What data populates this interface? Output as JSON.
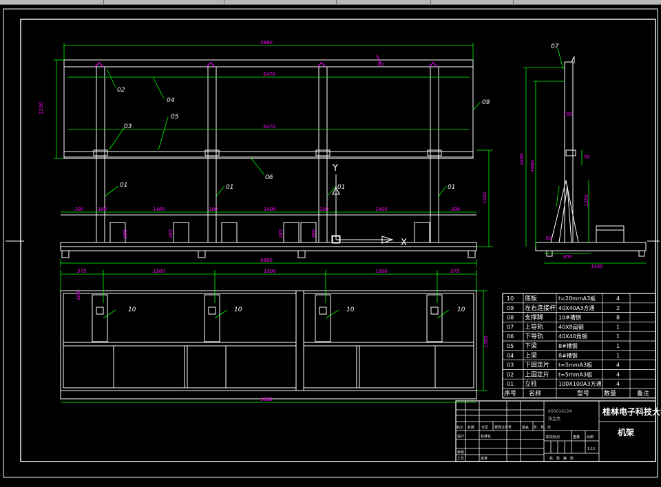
{
  "colors": {
    "background": "#000000",
    "line": "#ffffff",
    "dimension": "#00ff00",
    "label": "#ffffff",
    "leader": "#00ff00",
    "accent": "#ff00ff"
  },
  "front_view": {
    "dims": {
      "overall_top": "5880",
      "inner_top": "5470",
      "inner_mid": "5470",
      "left_height": "1230",
      "right_height": "1250",
      "base_width": "5880",
      "seg_left": "300",
      "seg_1": "1400",
      "seg_2": "1400",
      "seg_3": "1400",
      "seg_right": "300",
      "small_1": "100",
      "small_2": "100",
      "small_3": "100",
      "post_h1": "285",
      "post_h2": "285",
      "post_h3": "285",
      "post_h4": "300"
    },
    "callouts": [
      "02",
      "04",
      "03",
      "05",
      "06",
      "09",
      "01",
      "01",
      "01",
      "01"
    ],
    "axis_y": "Y",
    "axis_x": "X"
  },
  "side_view": {
    "callout": "07",
    "dims": {
      "total_height": "2480",
      "upper": "1980",
      "mid": "1250",
      "small": "100",
      "tiny_1": "50",
      "tiny_2": "50",
      "base_1": "850",
      "base_2": "1350"
    }
  },
  "top_view": {
    "dims": {
      "seg_left": "575",
      "seg_1": "1500",
      "seg_2": "1500",
      "seg_3": "1500",
      "seg_right": "575",
      "overall": "5880",
      "height": "1380",
      "small": "100"
    },
    "callouts": [
      "10",
      "10",
      "10",
      "10"
    ]
  },
  "bom": {
    "rows": [
      {
        "no": "10",
        "name": "底板",
        "spec": "t=20mmA3板",
        "qty": "4"
      },
      {
        "no": "09",
        "name": "左右连接杆",
        "spec": "40X40A3方通",
        "qty": "2"
      },
      {
        "no": "08",
        "name": "支撑脚",
        "spec": "10#槽钢",
        "qty": "8"
      },
      {
        "no": "07",
        "name": "上导轨",
        "spec": "40X8扁钢",
        "qty": "1"
      },
      {
        "no": "06",
        "name": "下导轨",
        "spec": "40X40角钢",
        "qty": "1"
      },
      {
        "no": "05",
        "name": "下梁",
        "spec": "8#槽钢",
        "qty": "1"
      },
      {
        "no": "04",
        "name": "上梁",
        "spec": "8#槽钢",
        "qty": "1"
      },
      {
        "no": "03",
        "name": "下固定片",
        "spec": "t=5mmA3板",
        "qty": "4"
      },
      {
        "no": "02",
        "name": "上固定片",
        "spec": "t=5mmA3板",
        "qty": "4"
      },
      {
        "no": "01",
        "name": "立柱",
        "spec": "100X100A3方通",
        "qty": "4"
      }
    ],
    "header": {
      "no": "序号",
      "name": "名称",
      "spec": "型号",
      "qty": "数量",
      "note": "备注"
    }
  },
  "title_block": {
    "university": "桂林电子科技大学",
    "drawing_name": "机架",
    "student_id": "050010124",
    "student_name": "张金亮",
    "scale": "1:15",
    "rev_headers": [
      "标记",
      "处数",
      "分区",
      "更改文件号",
      "签名",
      "年、月、日"
    ],
    "row_design": "设计",
    "row_std": "标准化",
    "row_review": "审核",
    "row_process": "工艺",
    "row_approve": "批准",
    "stage_headers": [
      "阶段标记",
      "重量",
      "比例"
    ],
    "sheet_text": "共　张　第　张"
  }
}
